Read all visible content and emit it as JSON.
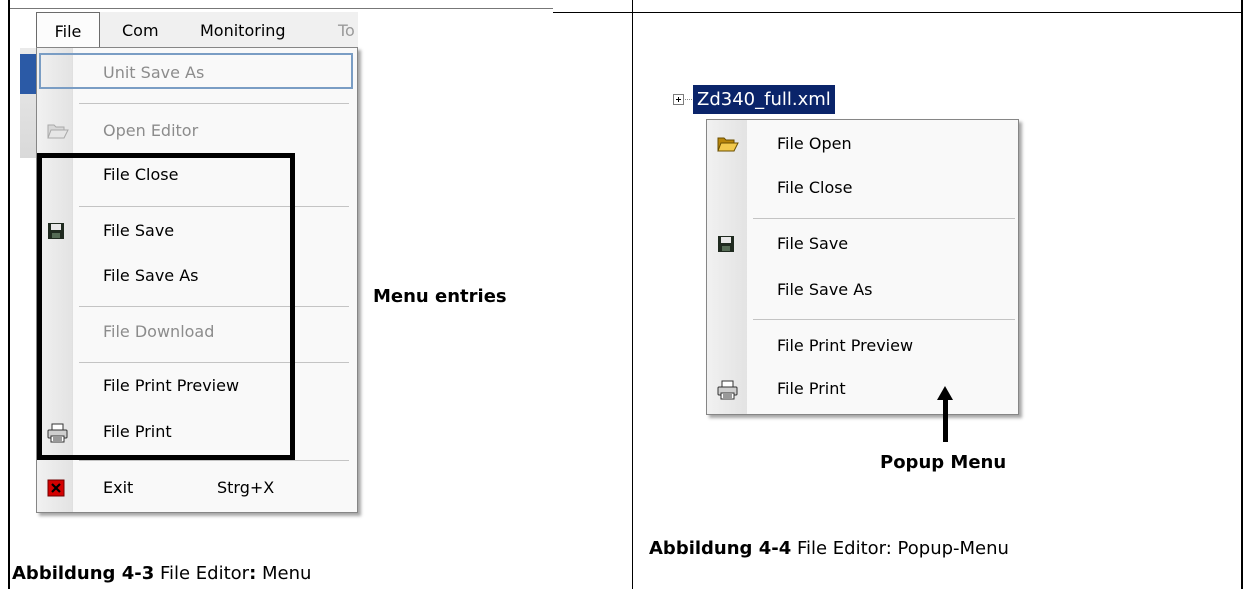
{
  "left_figure": {
    "menubar": {
      "tabs": [
        "File",
        "Com",
        "Monitoring",
        "To"
      ]
    },
    "menu": {
      "items": [
        {
          "label": "Unit Save As",
          "disabled": true,
          "icon": ""
        },
        {
          "label": "Open Editor",
          "disabled": true,
          "icon": "folder-open-icon"
        },
        {
          "label": "File Close",
          "disabled": false,
          "icon": ""
        },
        {
          "label": "File Save",
          "disabled": false,
          "icon": "floppy-disk-icon"
        },
        {
          "label": "File Save As",
          "disabled": false,
          "icon": ""
        },
        {
          "label": "File Download",
          "disabled": true,
          "icon": ""
        },
        {
          "label": "File Print Preview",
          "disabled": false,
          "icon": ""
        },
        {
          "label": "File Print",
          "disabled": false,
          "icon": "printer-icon"
        },
        {
          "label": "Exit",
          "shortcut": "Strg+X",
          "disabled": false,
          "icon": "close-icon"
        }
      ]
    },
    "callout": "Menu entries",
    "caption": {
      "prefix": "Abbildung 4-3",
      "text": " File Editor",
      "colon": ":",
      "suffix": " Menu"
    }
  },
  "right_figure": {
    "tree_node": "Zd340_full.xml",
    "popup": {
      "items": [
        {
          "label": "File Open",
          "icon": "folder-open-icon"
        },
        {
          "label": "File Close",
          "icon": ""
        },
        {
          "label": "File Save",
          "icon": "floppy-disk-icon"
        },
        {
          "label": "File Save As",
          "icon": ""
        },
        {
          "label": "File Print Preview",
          "icon": ""
        },
        {
          "label": "File Print",
          "icon": "printer-icon"
        }
      ]
    },
    "callout": "Popup Menu",
    "caption": {
      "prefix": "Abbildung 4-4",
      "text": " File Editor: Popup-Menu"
    }
  },
  "colors": {
    "selection": "#0a246a",
    "disabled_text": "#8c8c8c",
    "highlight_border": "#7a9dc4"
  }
}
